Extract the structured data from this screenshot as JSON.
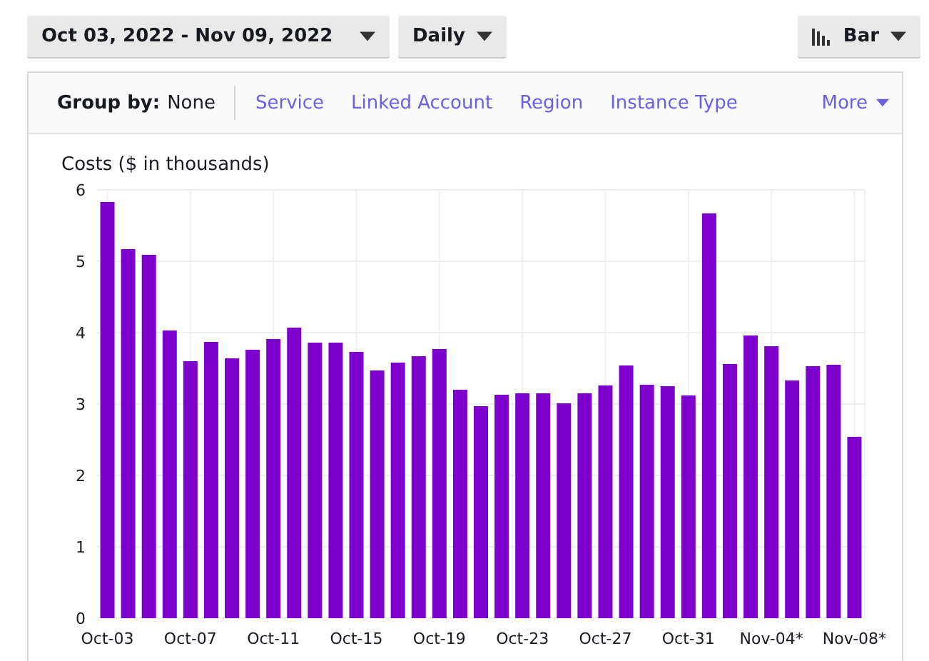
{
  "toolbar": {
    "date_range": "Oct 03, 2022 - Nov 09, 2022",
    "granularity": "Daily",
    "chart_type": "Bar"
  },
  "group_by": {
    "label": "Group by:",
    "value": "None",
    "options": [
      "Service",
      "Linked Account",
      "Region",
      "Instance Type"
    ],
    "more": "More"
  },
  "chart": {
    "chart_data": {
      "type": "bar",
      "ylabel": "Costs ($ in thousands)",
      "color": "#7d00cc",
      "ylim": [
        0,
        6
      ],
      "yticks": [
        0,
        1,
        2,
        3,
        4,
        5,
        6
      ],
      "values": [
        5.83,
        5.17,
        5.09,
        4.03,
        3.6,
        3.87,
        3.64,
        3.76,
        3.91,
        4.07,
        3.86,
        3.86,
        3.73,
        3.47,
        3.58,
        3.67,
        3.77,
        3.2,
        2.97,
        3.13,
        3.15,
        3.15,
        3.01,
        3.15,
        3.26,
        3.54,
        3.27,
        3.25,
        3.12,
        5.67,
        3.56,
        3.96,
        3.81,
        3.33,
        3.53,
        3.55,
        2.54
      ],
      "grid": true,
      "categories": [
        "Oct-03",
        null,
        null,
        null,
        "Oct-07",
        null,
        null,
        null,
        "Oct-11",
        null,
        null,
        null,
        "Oct-15",
        null,
        null,
        null,
        "Oct-19",
        null,
        null,
        null,
        "Oct-23",
        null,
        null,
        null,
        "Oct-27",
        null,
        null,
        null,
        "Oct-31",
        null,
        null,
        null,
        "Nov-04*",
        null,
        null,
        null,
        "Nov-08*"
      ]
    }
  }
}
